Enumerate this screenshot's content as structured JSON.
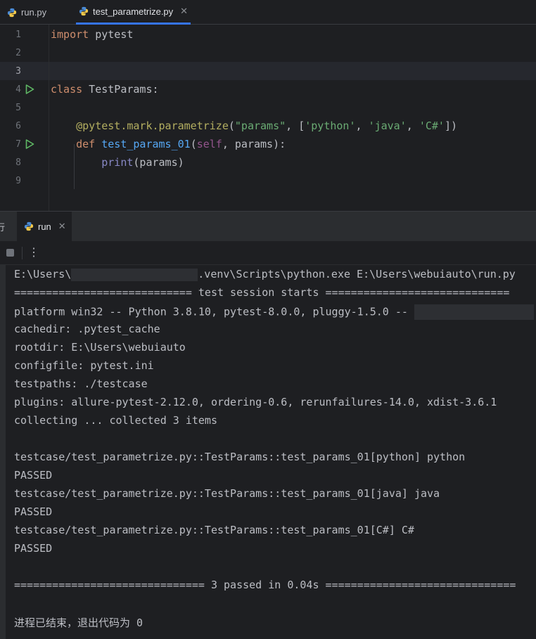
{
  "tabs": [
    {
      "label": "run.py",
      "active": false
    },
    {
      "label": "test_parametrize.py",
      "active": true
    }
  ],
  "editor": {
    "line_numbers": [
      "1",
      "2",
      "3",
      "4",
      "5",
      "6",
      "7",
      "8",
      "9"
    ],
    "current_line": 3,
    "code": {
      "l1_kw": "import",
      "l1_rest": " pytest",
      "l4_kw": "class",
      "l4_rest": " TestParams:",
      "l6_deco": "    @pytest.mark.parametrize",
      "l6_p1": "(",
      "l6_s1": "\"params\"",
      "l6_p2": ", [",
      "l6_s2": "'python'",
      "l6_p3": ", ",
      "l6_s3": "'java'",
      "l6_p4": ", ",
      "l6_s4": "'C#'",
      "l6_p5": "])",
      "l7_kw": "    def",
      "l7_sp": " ",
      "l7_fn": "test_params_01",
      "l7_p1": "(",
      "l7_self": "self",
      "l7_rest": ", params):",
      "l8_indent": "        ",
      "l8_fn": "print",
      "l8_rest": "(params)"
    }
  },
  "run_panel": {
    "left_label": "行",
    "tab_label": "run",
    "menu_glyph": "⋮"
  },
  "console": {
    "line_path_a": "E:\\Users\\",
    "line_path_b": ".venv\\Scripts\\python.exe E:\\Users\\webuiauto\\run.py",
    "session_start": "============================ test session starts =============================",
    "platform": "platform win32 -- Python 3.8.10, pytest-8.0.0, pluggy-1.5.0 -- ",
    "cachedir": "cachedir: .pytest_cache",
    "rootdir": "rootdir: E:\\Users\\webuiauto",
    "configfile": "configfile: pytest.ini",
    "testpaths": "testpaths: ./testcase",
    "plugins": "plugins: allure-pytest-2.12.0, ordering-0.6, rerunfailures-14.0, xdist-3.6.1",
    "collecting": "collecting ... collected 3 items",
    "t1": "testcase/test_parametrize.py::TestParams::test_params_01[python] python",
    "p1": "PASSED",
    "t2": "testcase/test_parametrize.py::TestParams::test_params_01[java] java",
    "p2": "PASSED",
    "t3": "testcase/test_parametrize.py::TestParams::test_params_01[C#] C#",
    "p3": "PASSED",
    "summary": "============================== 3 passed in 0.04s ==============================",
    "exit": "进程已结束，退出代码为 0"
  }
}
